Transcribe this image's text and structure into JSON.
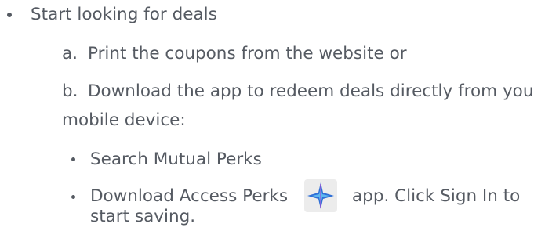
{
  "list": {
    "top_item": "Start looking for deals",
    "sub_items": [
      {
        "marker": "a.",
        "text": "Print the coupons from the website or"
      },
      {
        "marker": "b.",
        "text_line1": "Download the app to redeem deals directly from your",
        "text_line2": "mobile device:"
      }
    ],
    "nested_bullets": [
      {
        "text": "Search Mutual Perks"
      },
      {
        "text_before_icon": "Download Access Perks",
        "icon": "access-perks-app-icon",
        "text_after_icon": "app. Click Sign In to",
        "text_line2": "start saving."
      }
    ]
  },
  "colors": {
    "text": "#555a62",
    "icon_bg": "#ececec",
    "icon_blue": "#2f6fd6",
    "icon_light": "#5fb8f0"
  }
}
